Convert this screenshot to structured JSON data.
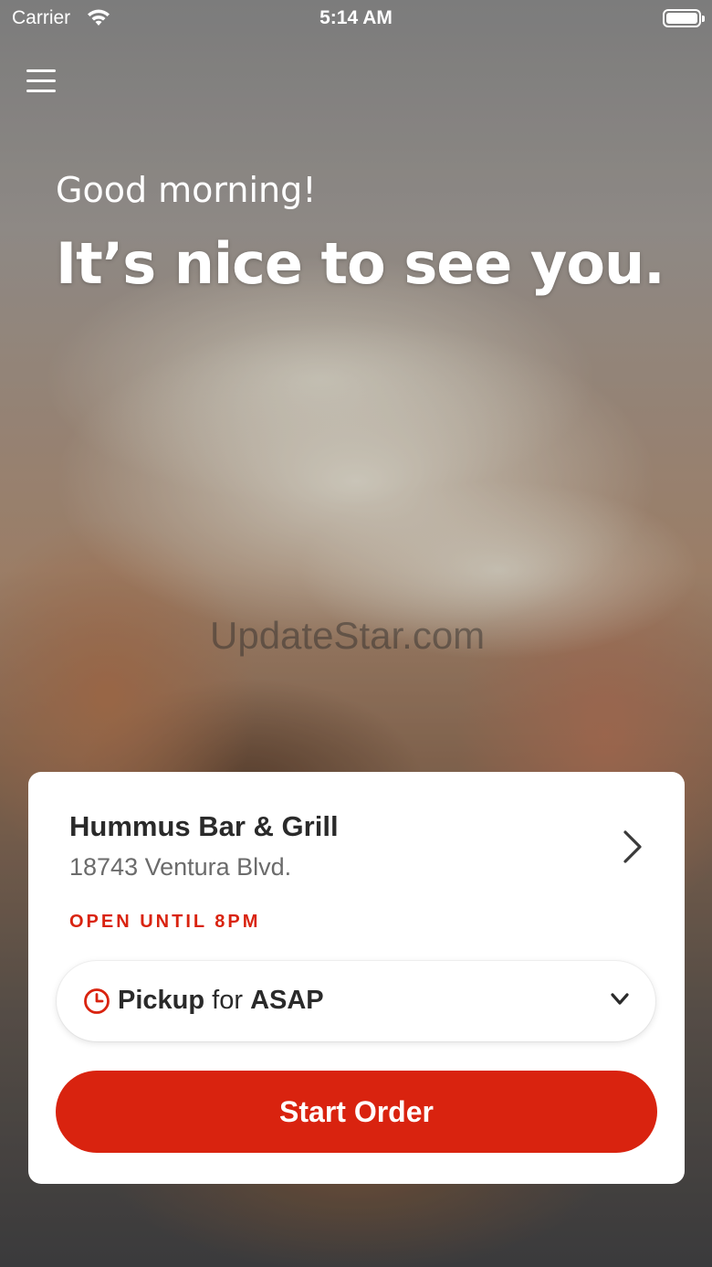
{
  "status_bar": {
    "carrier": "Carrier",
    "time": "5:14 AM"
  },
  "greeting": {
    "salutation": "Good morning!",
    "headline": "It’s nice to see you."
  },
  "watermark": "UpdateStar.com",
  "location": {
    "name": "Hummus Bar & Grill",
    "address": "18743 Ventura Blvd.",
    "open_status": "OPEN UNTIL 8PM"
  },
  "order_mode": {
    "mode": "Pickup",
    "connector": "for",
    "time": "ASAP"
  },
  "actions": {
    "start_order": "Start Order"
  },
  "colors": {
    "accent": "#d9230f",
    "card_background": "#ffffff",
    "text_primary": "#2a2a2a",
    "text_secondary": "#6b6b6b"
  },
  "icons": {
    "menu": "hamburger-menu-icon",
    "wifi": "wifi-icon",
    "battery": "battery-icon",
    "location_chevron": "chevron-right-icon",
    "clock": "clock-icon",
    "dropdown": "chevron-down-icon"
  }
}
